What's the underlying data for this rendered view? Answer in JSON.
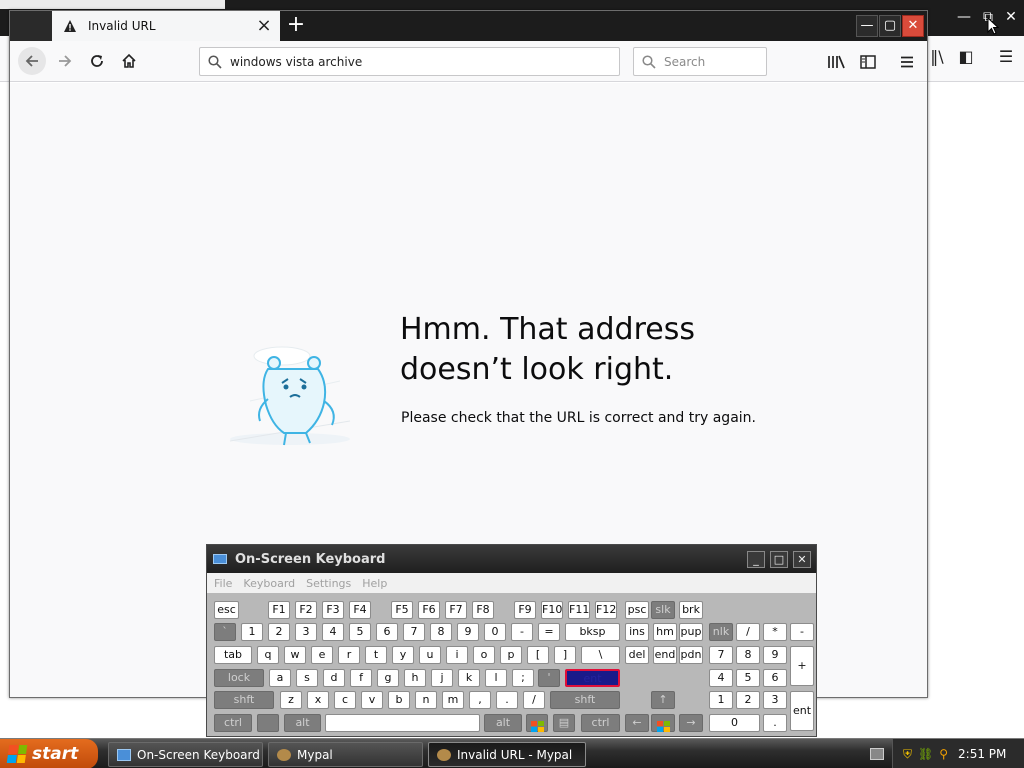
{
  "tab": {
    "title": "Invalid URL"
  },
  "url": {
    "value": "windows vista archive"
  },
  "search": {
    "placeholder": "Search"
  },
  "error": {
    "title": "Hmm. That address doesn’t look right.",
    "message": "Please check that the URL is correct and try again."
  },
  "osk": {
    "title": "On-Screen Keyboard",
    "menu": [
      "File",
      "Keyboard",
      "Settings",
      "Help"
    ],
    "highlighted_key": "ent",
    "keys": [
      {
        "label": "esc"
      },
      {
        "label": "F1"
      },
      {
        "label": "F2"
      },
      {
        "label": "F3"
      },
      {
        "label": "F4"
      },
      {
        "label": "F5"
      },
      {
        "label": "F6"
      },
      {
        "label": "F7"
      },
      {
        "label": "F8"
      },
      {
        "label": "F9"
      },
      {
        "label": "F10"
      },
      {
        "label": "F11"
      },
      {
        "label": "F12"
      },
      {
        "label": "psc"
      },
      {
        "label": "slk"
      },
      {
        "label": "brk"
      },
      {
        "label": "`"
      },
      {
        "label": "1"
      },
      {
        "label": "2"
      },
      {
        "label": "3"
      },
      {
        "label": "4"
      },
      {
        "label": "5"
      },
      {
        "label": "6"
      },
      {
        "label": "7"
      },
      {
        "label": "8"
      },
      {
        "label": "9"
      },
      {
        "label": "0"
      },
      {
        "label": "-"
      },
      {
        "label": "="
      },
      {
        "label": "bksp"
      },
      {
        "label": "ins"
      },
      {
        "label": "hm"
      },
      {
        "label": "pup"
      },
      {
        "label": "nlk"
      },
      {
        "label": "/"
      },
      {
        "label": "*"
      },
      {
        "label": "-"
      },
      {
        "label": "tab"
      },
      {
        "label": "q"
      },
      {
        "label": "w"
      },
      {
        "label": "e"
      },
      {
        "label": "r"
      },
      {
        "label": "t"
      },
      {
        "label": "y"
      },
      {
        "label": "u"
      },
      {
        "label": "i"
      },
      {
        "label": "o"
      },
      {
        "label": "p"
      },
      {
        "label": "["
      },
      {
        "label": "]"
      },
      {
        "label": "\\"
      },
      {
        "label": "del"
      },
      {
        "label": "end"
      },
      {
        "label": "pdn"
      },
      {
        "label": "7"
      },
      {
        "label": "8"
      },
      {
        "label": "9"
      },
      {
        "label": "+"
      },
      {
        "label": "lock"
      },
      {
        "label": "a"
      },
      {
        "label": "s"
      },
      {
        "label": "d"
      },
      {
        "label": "f"
      },
      {
        "label": "g"
      },
      {
        "label": "h"
      },
      {
        "label": "j"
      },
      {
        "label": "k"
      },
      {
        "label": "l"
      },
      {
        "label": ";"
      },
      {
        "label": "'"
      },
      {
        "label": "ent"
      },
      {
        "label": "4"
      },
      {
        "label": "5"
      },
      {
        "label": "6"
      },
      {
        "label": "shft"
      },
      {
        "label": "z"
      },
      {
        "label": "x"
      },
      {
        "label": "c"
      },
      {
        "label": "v"
      },
      {
        "label": "b"
      },
      {
        "label": "n"
      },
      {
        "label": "m"
      },
      {
        "label": ","
      },
      {
        "label": "."
      },
      {
        "label": "/"
      },
      {
        "label": "shft"
      },
      {
        "label": "↑"
      },
      {
        "label": "1"
      },
      {
        "label": "2"
      },
      {
        "label": "3"
      },
      {
        "label": "ent"
      },
      {
        "label": "ctrl"
      },
      {
        "label": ""
      },
      {
        "label": "alt"
      },
      {
        "label": ""
      },
      {
        "label": "alt"
      },
      {
        "label": ""
      },
      {
        "label": "▤"
      },
      {
        "label": "ctrl"
      },
      {
        "label": "←"
      },
      {
        "label": "↓"
      },
      {
        "label": "→"
      },
      {
        "label": "0"
      },
      {
        "label": "."
      }
    ]
  },
  "taskbar": {
    "start_label": "start",
    "items": [
      {
        "label": "On-Screen Keyboard"
      },
      {
        "label": "Mypal"
      },
      {
        "label": "Invalid URL - Mypal"
      }
    ],
    "clock": "2:51 PM"
  },
  "colors": {
    "titlebar": "#1c1c1c",
    "close_button": "#d94b3b",
    "start_button": "#d85a14",
    "osk_highlight": "#1a1a8a"
  }
}
